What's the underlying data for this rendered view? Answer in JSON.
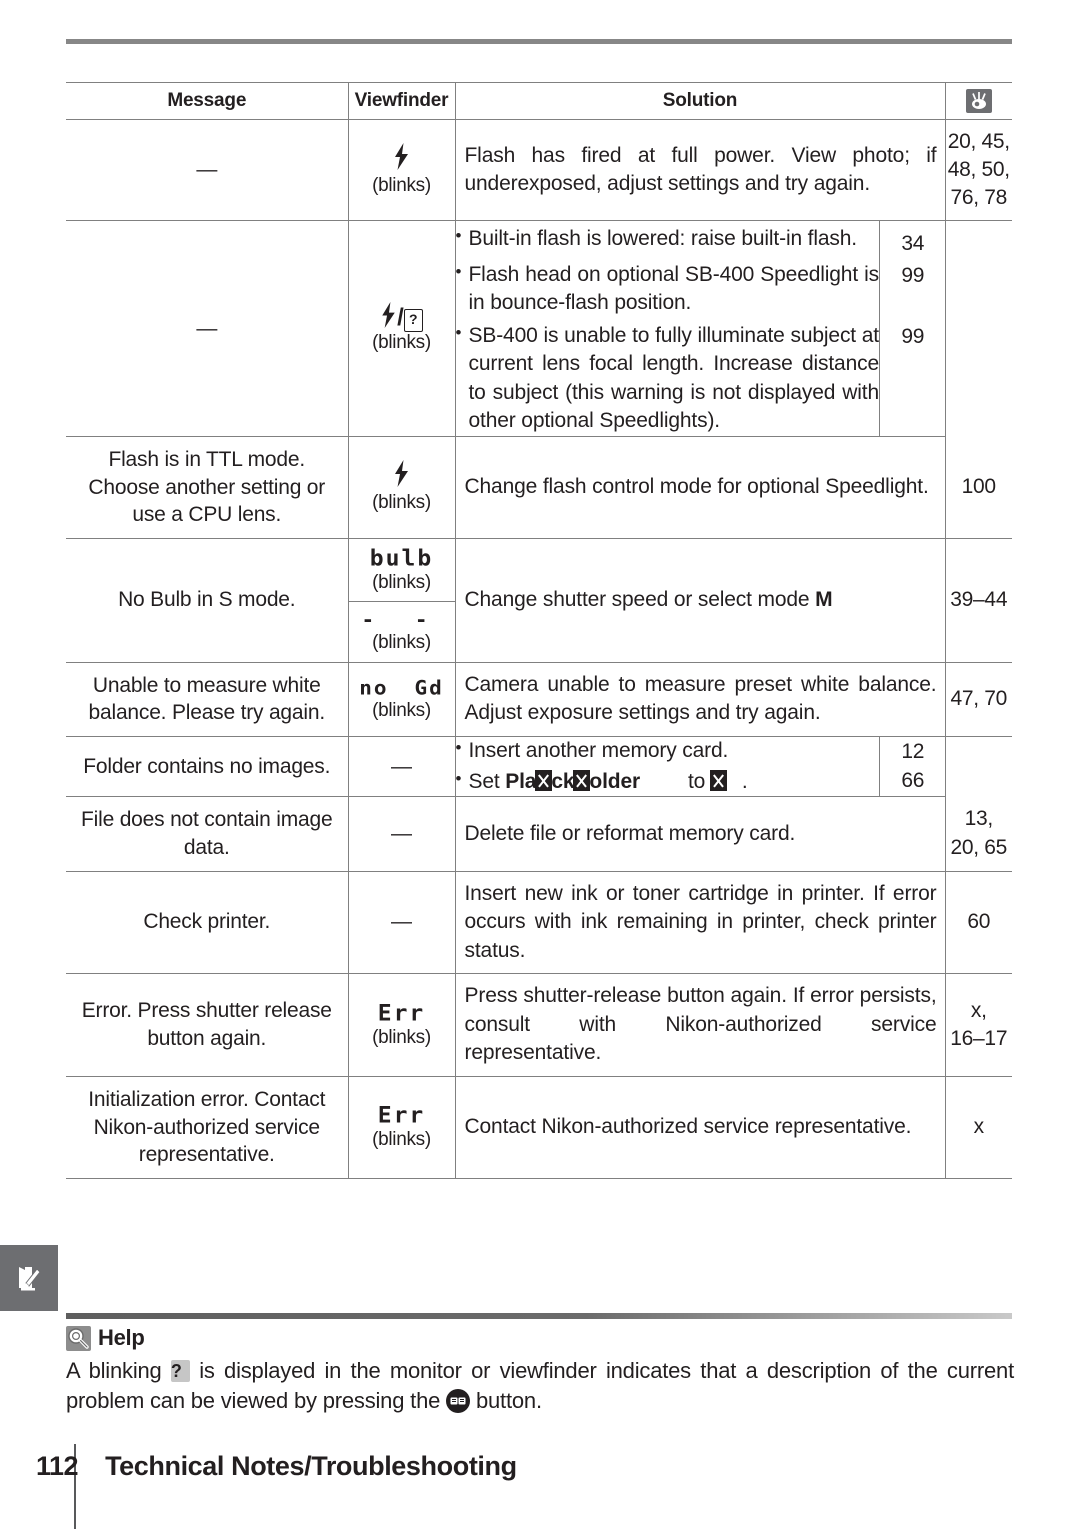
{
  "document": {
    "folio": "112",
    "running_title": "Technical Notes/Troubleshooting",
    "side_tab_icon": "note-pencil-icon"
  },
  "table": {
    "columns": {
      "message": "Message",
      "viewfinder": "Viewfinder",
      "solution": "Solution",
      "page_ref_icon": "reference-page-icon"
    },
    "rows": [
      {
        "message": "—",
        "viewfinder_glyph": "flash-bolt-icon",
        "viewfinder_note": "(blinks)",
        "solution": "Flash has fired at full power.  View photo; if underexposed, adjust settings and try again.",
        "pages": "20, 45, 48, 50, 76, 78",
        "pages_lines": [
          "20, 45,",
          "48, 50,",
          "76, 78"
        ]
      },
      {
        "message": "—",
        "viewfinder_glyph": "flash-bolt-slash-question-icon",
        "viewfinder_note": "(blinks)",
        "solution_items": [
          {
            "text": "Built-in flash is lowered: raise built-in flash.",
            "page": "34"
          },
          {
            "text": "Flash head on optional SB-400 Speedlight is in bounce-flash position.",
            "page": "99"
          },
          {
            "text": "SB-400 is unable to fully illuminate subject at current lens focal length.  Increase distance to subject (this warning is not displayed with other optional Speedlights).",
            "page": "99"
          }
        ]
      },
      {
        "message": "Flash is in TTL mode.  Choose another setting or use a CPU lens.",
        "viewfinder_glyph": "flash-bolt-icon",
        "viewfinder_note": "(blinks)",
        "solution": "Change flash control mode for optional Speedlight.",
        "pages": "100"
      },
      {
        "message": "No Bulb in S mode.",
        "viewfinder_lcd_top": "bulb",
        "viewfinder_note_top": "(blinks)",
        "viewfinder_lcd_bottom": "- -",
        "viewfinder_note_bottom": "(blinks)",
        "solution_prefix": "Change shutter speed or select mode ",
        "solution_mode": "M",
        "pages": "39–44"
      },
      {
        "message": "Unable to measure white balance.  Please try again.",
        "viewfinder_lcd_left": "no",
        "viewfinder_lcd_right": "Gd",
        "viewfinder_note": "(blinks)",
        "solution": "Camera unable to measure preset white balance.  Adjust exposure settings and try again.",
        "pages": "47, 70"
      },
      {
        "message": "Folder contains no images.",
        "viewfinder_glyph": "em-dash",
        "solution_items": [
          {
            "text": "Insert another memory card.",
            "page": "12"
          },
          {
            "text_prefix": "Set ",
            "bold_before": "Pla",
            "bold_after": "ck",
            "bold_tail": "older",
            "text_mid": "to",
            "text_suffix": ".",
            "page": "66",
            "full_text": "Set Playback folder to All."
          }
        ]
      },
      {
        "message": "File does not contain image data.",
        "viewfinder_glyph": "em-dash",
        "solution": "Delete file or reformat memory card.",
        "pages": "13, 20, 65",
        "pages_lines": [
          "13,",
          "20, 65"
        ]
      },
      {
        "message": "Check printer.",
        "viewfinder_glyph": "em-dash",
        "solution": "Insert new ink or toner cartridge in printer.  If error occurs with ink remaining in printer, check printer status.",
        "pages": "60"
      },
      {
        "message": "Error.  Press shutter release button again.",
        "viewfinder_lcd": "Err",
        "viewfinder_note": "(blinks)",
        "solution": "Press shutter-release button again.  If error persists, consult with Nikon-authorized service representative.",
        "pages": "x, 16–17",
        "pages_lines": [
          "x,",
          "16–17"
        ]
      },
      {
        "message": "Initialization error.  Contact Nikon-authorized service representative.",
        "viewfinder_lcd": "Err",
        "viewfinder_note": "(blinks)",
        "solution": "Contact Nikon-authorized service representative.",
        "pages": "x"
      }
    ]
  },
  "help": {
    "icon": "magnifier-bulb-icon",
    "title": "Help",
    "text_part1": "A blinking ",
    "badge": "?",
    "text_part2": " is displayed in the monitor or viewfinder indicates that a description of the current problem can be viewed by pressing the ",
    "button_icon": "qm-button-icon",
    "text_part3": " button."
  },
  "colors": {
    "rule_gray": "#878787",
    "table_line": "#808080",
    "tab_gray": "#6d6e71",
    "text": "#231f20"
  }
}
